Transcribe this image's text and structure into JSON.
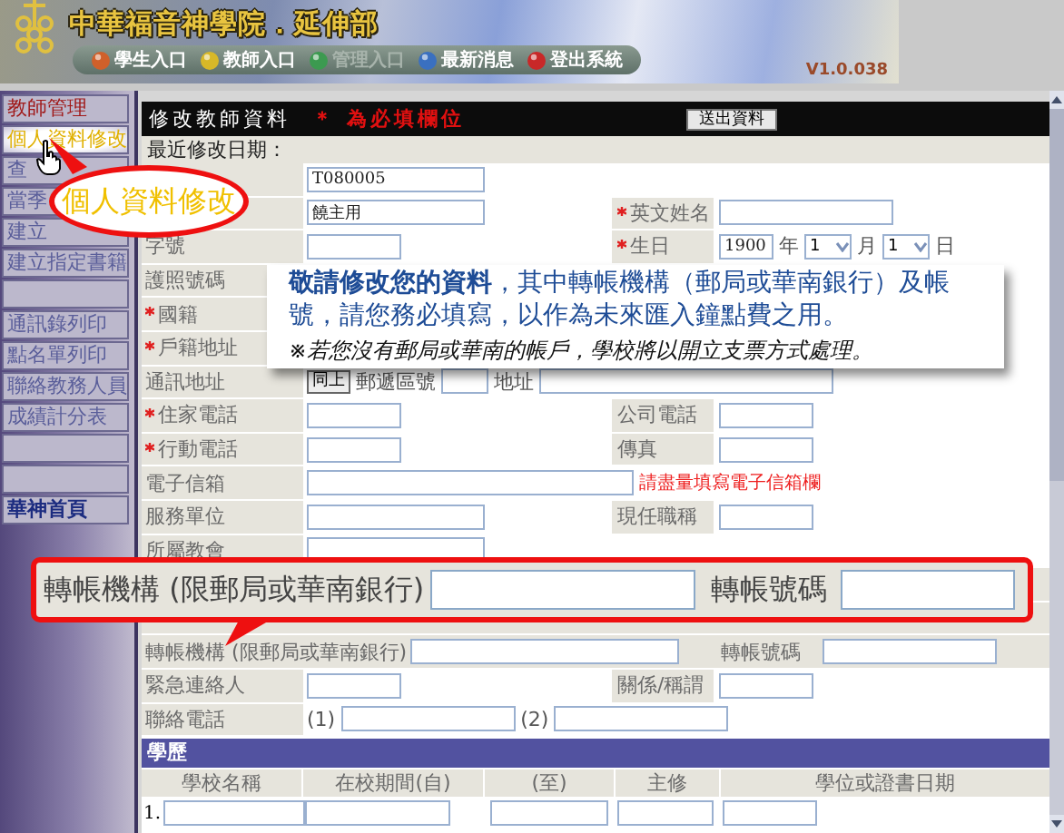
{
  "header": {
    "title": "中華福音神學院．延伸部",
    "version": "V1.0.038",
    "nav": [
      {
        "label": "學生入口",
        "disabled": false,
        "color": "#d0602a"
      },
      {
        "label": "教師入口",
        "disabled": false,
        "color": "#d8b828"
      },
      {
        "label": "管理入口",
        "disabled": true,
        "color": "#3c9a50"
      },
      {
        "label": "最新消息",
        "disabled": false,
        "color": "#3a70c0"
      },
      {
        "label": "登出系統",
        "disabled": false,
        "color": "#c82828"
      }
    ]
  },
  "sidebar": {
    "items": [
      {
        "kind": "heading",
        "label": "教師管理"
      },
      {
        "kind": "link",
        "label": "個人資料修改",
        "selected": true
      },
      {
        "kind": "link",
        "label": "查",
        "selected": false
      },
      {
        "kind": "link",
        "label": "當季",
        "selected": false
      },
      {
        "kind": "link",
        "label": "建立",
        "selected": false
      },
      {
        "kind": "link",
        "label": "建立指定書籍",
        "selected": false
      },
      {
        "kind": "blank"
      },
      {
        "kind": "link",
        "label": "通訊錄列印",
        "selected": false
      },
      {
        "kind": "link",
        "label": "點名單列印",
        "selected": false
      },
      {
        "kind": "link",
        "label": "聯絡教務人員",
        "selected": false
      },
      {
        "kind": "link",
        "label": "成績計分表",
        "selected": false
      },
      {
        "kind": "blank"
      },
      {
        "kind": "blank"
      },
      {
        "kind": "home",
        "label": "華神首頁"
      }
    ]
  },
  "form": {
    "title": "修改教師資料",
    "required_note": "＊ 為必填欄位",
    "submit": "送出資料",
    "last_modified": "最近修改日期：",
    "rows": [
      {
        "kind": "field",
        "items": [
          {
            "kind": "input",
            "value": "T080005"
          }
        ]
      },
      {
        "kind": "field",
        "items": [
          {
            "kind": "input",
            "value": "饒主用"
          }
        ],
        "right": {
          "label": "英文姓名",
          "required": true,
          "items": [
            {
              "kind": "input"
            }
          ]
        }
      },
      {
        "kind": "field",
        "label": "字號",
        "required": false,
        "items": [
          {
            "kind": "input"
          }
        ],
        "right": {
          "label": "生日",
          "required": true,
          "items": [
            {
              "kind": "input",
              "value": "1900"
            },
            {
              "kind": "text",
              "text": "年"
            },
            {
              "kind": "select",
              "value": "1"
            },
            {
              "kind": "text",
              "text": "月"
            },
            {
              "kind": "select",
              "value": "1"
            },
            {
              "kind": "text",
              "text": "日"
            }
          ]
        }
      },
      {
        "kind": "field",
        "label": "護照號碼",
        "required": false
      },
      {
        "kind": "field",
        "label": "國籍",
        "required": true
      },
      {
        "kind": "field",
        "label": "戶籍地址",
        "required": true
      },
      {
        "kind": "field",
        "label": "通訊地址",
        "required": false,
        "items": [
          {
            "kind": "button",
            "text": "同上"
          },
          {
            "kind": "text",
            "text": "郵遞區號"
          },
          {
            "kind": "input"
          },
          {
            "kind": "text",
            "text": "地址"
          },
          {
            "kind": "input"
          }
        ]
      },
      {
        "kind": "field",
        "label": "住家電話",
        "required": true,
        "items": [
          {
            "kind": "input"
          }
        ],
        "right": {
          "label": "公司電話",
          "required": false,
          "items": [
            {
              "kind": "input"
            }
          ]
        }
      },
      {
        "kind": "field",
        "label": "行動電話",
        "required": true,
        "items": [
          {
            "kind": "input"
          }
        ],
        "right": {
          "label": "傳真",
          "required": false,
          "items": [
            {
              "kind": "input"
            }
          ]
        }
      },
      {
        "kind": "field",
        "label": "電子信箱",
        "required": false,
        "items": [
          {
            "kind": "input"
          },
          {
            "kind": "note",
            "text": "請盡量填寫電子信箱欄"
          }
        ]
      },
      {
        "kind": "field",
        "label": "服務單位",
        "required": false,
        "items": [
          {
            "kind": "input"
          }
        ],
        "right": {
          "label": "現任職稱",
          "required": false,
          "items": [
            {
              "kind": "input"
            }
          ]
        }
      },
      {
        "kind": "field",
        "label": "所屬教會",
        "required": false,
        "items": [
          {
            "kind": "input"
          }
        ]
      },
      {
        "kind": "covered"
      },
      {
        "kind": "covered"
      },
      {
        "kind": "field",
        "label": "轉帳機構 (限郵局或華南銀行)",
        "required": false,
        "items": [
          {
            "kind": "input"
          }
        ],
        "right": {
          "label": "轉帳號碼",
          "required": false,
          "items": [
            {
              "kind": "input"
            }
          ]
        }
      },
      {
        "kind": "field",
        "label": "緊急連絡人",
        "required": false,
        "items": [
          {
            "kind": "input"
          }
        ],
        "right": {
          "label": "關係/稱謂",
          "required": false,
          "items": [
            {
              "kind": "input"
            }
          ]
        }
      },
      {
        "kind": "field",
        "label": "聯絡電話",
        "required": false,
        "items": [
          {
            "kind": "text",
            "text": "(1)"
          },
          {
            "kind": "input"
          },
          {
            "kind": "text",
            "text": "(2)"
          },
          {
            "kind": "input"
          }
        ]
      }
    ]
  },
  "education": {
    "title": "學歷",
    "columns": [
      "學校名稱",
      "在校期間(自)",
      "(至)",
      "主修",
      "學位或證書日期"
    ],
    "rows": [
      {
        "number": "1."
      }
    ]
  },
  "notice": {
    "message": "**敬請修改您的資料**，其中轉帳機構（郵局或華南銀行）及帳號，請您務必填寫，以作為未來匯入鐘點費之用。",
    "note": "※若您沒有郵局或華南的帳戶，學校將以開立支票方式處理。"
  },
  "menu_callout": {
    "text": "個人資料修改"
  },
  "bank_callout": {
    "label": "轉帳機構 (限郵局或華南銀行)",
    "account_label": "轉帳號碼"
  }
}
